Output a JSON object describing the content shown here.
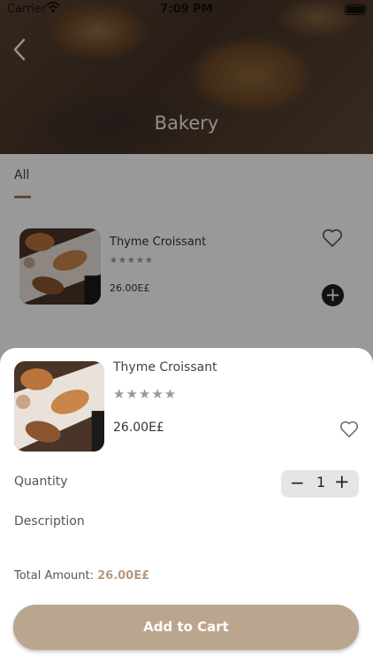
{
  "status_bar": {
    "carrier": "Carrier",
    "time": "7:09 PM"
  },
  "header": {
    "title": "Bakery",
    "back_icon": "chevron-left-icon"
  },
  "tabs": [
    {
      "label": "All",
      "active": true
    }
  ],
  "list": {
    "items": [
      {
        "name": "Thyme Croissant",
        "rating": "★★★★★",
        "price": "26.00E£"
      }
    ]
  },
  "sheet": {
    "name": "Thyme Croissant",
    "rating": "★★★★★",
    "price": "26.00E£",
    "quantity_label": "Quantity",
    "quantity_value": "1",
    "description_label": "Description",
    "total_label": "Total Amount:",
    "total_value": "26.00E£",
    "add_button": "Add to Cart"
  },
  "colors": {
    "accent": "#baa68f",
    "total": "#b79a80",
    "tab_underline": "#9a7b63"
  }
}
